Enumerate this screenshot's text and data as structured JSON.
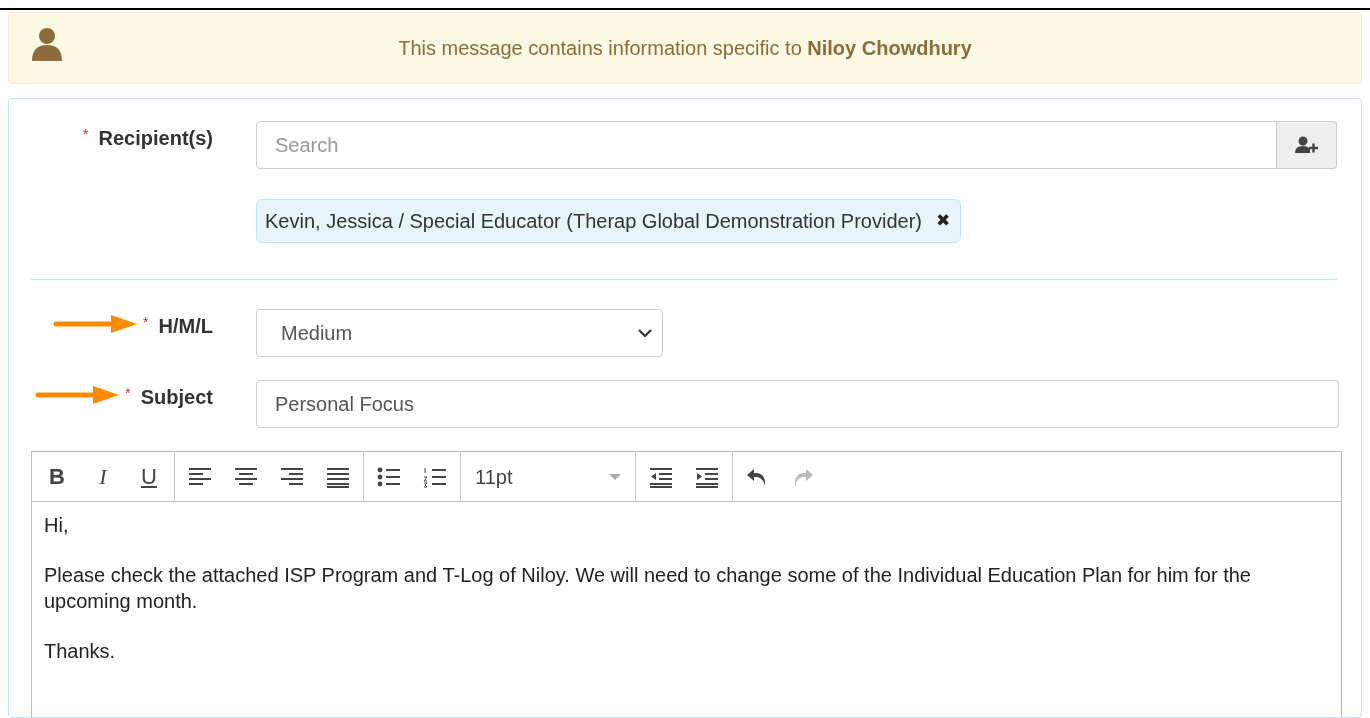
{
  "notice": {
    "text": "This message contains information specific to **Niloy Chowdhury**"
  },
  "recipients": {
    "label": "Recipient(s)",
    "required_mark": "*",
    "placeholder": "Search",
    "selected": [
      {
        "text": "Kevin, Jessica / Special Educator (Therap Global Demonstration Provider)",
        "remove": "✖"
      }
    ]
  },
  "fields": [
    {
      "kind": "select",
      "label": "H/M/L",
      "required_mark": "*",
      "marked": true,
      "value": "Medium"
    },
    {
      "kind": "text",
      "label": "Subject",
      "required_mark": "*",
      "marked": true,
      "value": "Personal Focus"
    }
  ],
  "toolbar": [
    [
      {
        "kind": "bold",
        "label": "B",
        "disabled": false
      },
      {
        "kind": "italic",
        "label": "I",
        "disabled": false
      },
      {
        "kind": "underline",
        "label": "U",
        "disabled": false
      }
    ],
    [
      {
        "kind": "align-left",
        "disabled": false
      },
      {
        "kind": "align-center",
        "disabled": false
      },
      {
        "kind": "align-right",
        "disabled": false
      },
      {
        "kind": "justify",
        "disabled": false
      }
    ],
    [
      {
        "kind": "bullet-list",
        "disabled": false
      },
      {
        "kind": "numbered-list",
        "disabled": false
      }
    ],
    [
      {
        "kind": "font-size",
        "label": "11pt",
        "disabled": false
      }
    ],
    [
      {
        "kind": "outdent",
        "disabled": false
      },
      {
        "kind": "indent",
        "disabled": false
      }
    ],
    [
      {
        "kind": "undo",
        "disabled": false
      },
      {
        "kind": "redo",
        "disabled": true
      }
    ]
  ],
  "body": [
    "Hi,",
    "Please check the attached ISP Program and T-Log of Niloy. We will need to change some of the Individual Education Plan for him for the upcoming month.",
    "Thanks."
  ]
}
